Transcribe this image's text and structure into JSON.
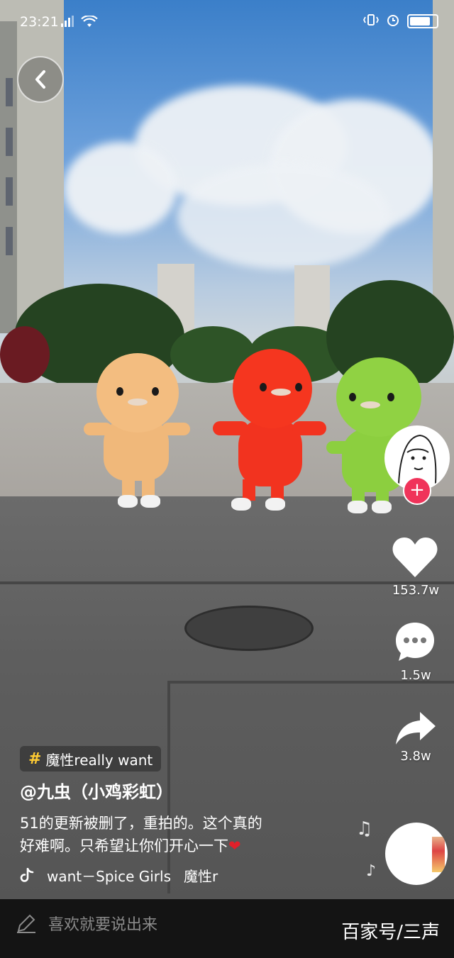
{
  "status_bar": {
    "time": "23:21",
    "icons": [
      "signal-icon",
      "wifi-icon",
      "vibrate-icon",
      "alarm-icon",
      "battery-icon"
    ]
  },
  "nav": {
    "back_icon": "chevron-left-icon"
  },
  "actions": {
    "likes": "153.7w",
    "comments": "1.5w",
    "shares": "3.8w",
    "like_color": "#ffffff",
    "follow_color": "#f0335a"
  },
  "post": {
    "topic": "魔性really want",
    "author": "@九虫（小鸡彩虹）",
    "description_line1": "51的更新被删了，重拍的。这个真的",
    "description_line2": "好难啊。只希望让你们开心一下",
    "music_title": "want－Spice Girls",
    "music_tag": "魔性r"
  },
  "comment_bar": {
    "placeholder": "喜欢就要说出来"
  },
  "watermark": "百家号/三声"
}
